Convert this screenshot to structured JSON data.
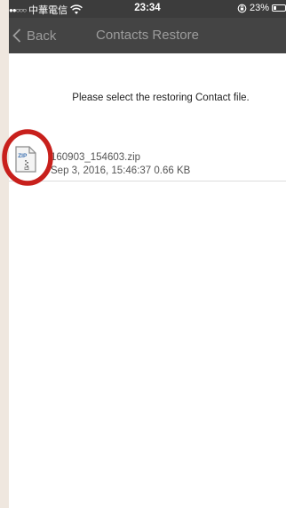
{
  "status_bar": {
    "signal": "●●○○○",
    "carrier": "中華電信",
    "time": "23:34",
    "battery_percent": "23%",
    "battery_level": 0.23
  },
  "nav": {
    "back_label": "Back",
    "title": "Contacts Restore"
  },
  "main": {
    "instruction": "Please select the restoring Contact file.",
    "files": [
      {
        "name": "160903_154603.zip",
        "date": "Sep 3, 2016, 15:46:37",
        "size": "0.66 KB",
        "icon": "zip-file-icon",
        "icon_label": "ZIP"
      }
    ]
  },
  "annotation": {
    "highlight_color": "#c8201c",
    "shape": "circle"
  }
}
